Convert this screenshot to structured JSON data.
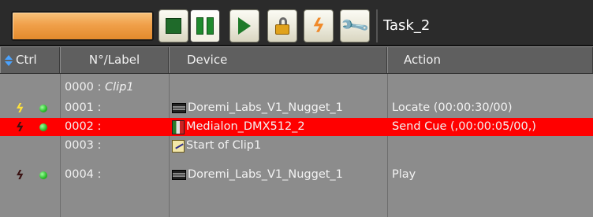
{
  "toolbar": {
    "progress_color": "#f0a04a",
    "buttons": [
      {
        "name": "stop-icon"
      },
      {
        "name": "pause-icon"
      },
      {
        "name": "play-icon"
      },
      {
        "name": "lock-icon"
      },
      {
        "name": "bolt-icon"
      },
      {
        "name": "wrench-icon"
      }
    ],
    "task_title": "Task_2"
  },
  "header": {
    "ctrl": "Ctrl",
    "label": "N°/Label",
    "device": "Device",
    "action": "Action"
  },
  "rows": [
    {
      "label": "0000 :",
      "clip": "Clip1",
      "device": "",
      "action": ""
    },
    {
      "label": "0001 :",
      "device": "Doremi_Labs_V1_Nugget_1",
      "action": "Locate (00:00:30/00)"
    },
    {
      "label": "0002 :",
      "device": "Medialon_DMX512_2",
      "action": "Send Cue (,00:00:05/00,)"
    },
    {
      "label": "0003 :",
      "device": "Start of Clip1",
      "action": ""
    },
    {
      "label": "0004 :",
      "device": "Doremi_Labs_V1_Nugget_1",
      "action": "Play"
    }
  ],
  "colors": {
    "selected_row": "#ff0000",
    "status_dot": "#2fc12f",
    "bolt_active": "#ffe23a"
  }
}
